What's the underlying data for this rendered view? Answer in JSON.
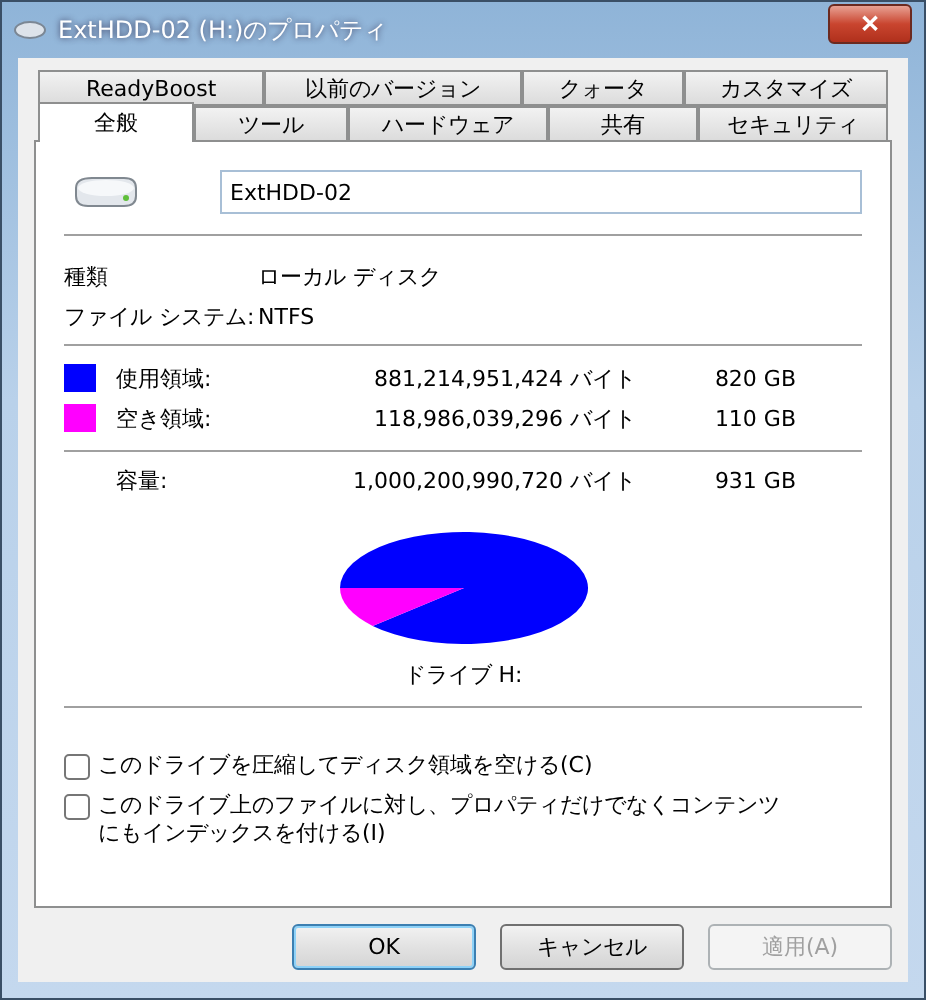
{
  "window": {
    "title": "ExtHDD-02 (H:)のプロパティ",
    "close": "✕"
  },
  "tab_rows": [
    [
      {
        "label": "ReadyBoost",
        "selected": false
      },
      {
        "label": "以前のバージョン",
        "selected": false
      },
      {
        "label": "クォータ",
        "selected": false
      },
      {
        "label": "カスタマイズ",
        "selected": false
      }
    ],
    [
      {
        "label": "全般",
        "selected": true
      },
      {
        "label": "ツール",
        "selected": false
      },
      {
        "label": "ハードウェア",
        "selected": false
      },
      {
        "label": "共有",
        "selected": false
      },
      {
        "label": "セキュリティ",
        "selected": false
      }
    ]
  ],
  "name_field": {
    "value": "ExtHDD-02"
  },
  "info": [
    {
      "label": "種類",
      "value": "ローカル ディスク"
    },
    {
      "label": "ファイル システム:",
      "value": "NTFS"
    }
  ],
  "space": [
    {
      "label": "使用領域:",
      "bytes": "881,214,951,424 バイト",
      "size": "820 GB",
      "color": "#0000ff"
    },
    {
      "label": "空き領域:",
      "bytes": "118,986,039,296 バイト",
      "size": "110 GB",
      "color": "#ff00ff"
    }
  ],
  "capacity": {
    "label": "容量:",
    "bytes": "1,000,200,990,720 バイト",
    "size": "931 GB"
  },
  "drive_label": "ドライブ H:",
  "options": [
    {
      "label": "このドライブを圧縮してディスク領域を空ける(C)",
      "checked": false
    },
    {
      "label": "このドライブ上のファイルに対し、プロパティだけでなくコンテンツにもインデックスを付ける(I)",
      "checked": false
    }
  ],
  "buttons": [
    {
      "label": "OK",
      "kind": "default",
      "disabled": false
    },
    {
      "label": "キャンセル",
      "kind": "normal",
      "disabled": false
    },
    {
      "label": "適用(A)",
      "kind": "normal",
      "disabled": true
    }
  ]
}
